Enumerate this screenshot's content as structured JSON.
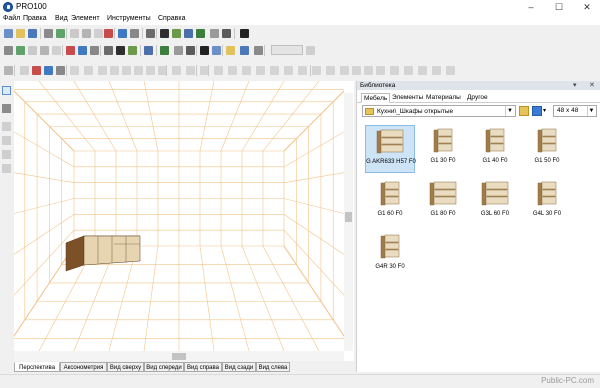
{
  "window": {
    "title": "PRO100",
    "controls": [
      "–",
      "☐",
      "✕"
    ]
  },
  "menu": [
    "Файл",
    "Правка",
    "Вид",
    "Элемент",
    "Инструменты",
    "Справка"
  ],
  "toolbar": {
    "row1_icons": [
      "new-icon",
      "open-icon",
      "save-icon",
      "print-icon",
      "preview-icon",
      "cut-icon",
      "copy-icon",
      "paste-icon",
      "delete-icon",
      "globe-icon",
      "sphere-icon",
      "export-icon",
      "properties-icon",
      "image-icon",
      "layers-icon",
      "report-icon",
      "clone-icon",
      "list-icon",
      "sigma-icon"
    ],
    "zoom_value": ""
  },
  "viewport": {
    "name": "3D-view"
  },
  "view_tabs": [
    "Перспектива",
    "Аксонометрия",
    "Вид сверху",
    "Вид спереди",
    "Вид справа",
    "Вид сзади",
    "Вид слева"
  ],
  "library": {
    "title": "Библиотека",
    "header_buttons": [
      "▾",
      "✕"
    ],
    "tabs": [
      "Мебель",
      "Элементы",
      "Материалы",
      "Другое"
    ],
    "path": "Кухни\\_Шкафы открытые",
    "size": "48 x  48",
    "items": [
      {
        "label": "G AKR633 H57 F0",
        "selected": true,
        "kind": "wide"
      },
      {
        "label": "G1 30 F0",
        "selected": false,
        "kind": "tall"
      },
      {
        "label": "G1 40 F0",
        "selected": false,
        "kind": "tall"
      },
      {
        "label": "G1 50 F0",
        "selected": false,
        "kind": "tall"
      },
      {
        "label": "G1 60 F0",
        "selected": false,
        "kind": "tall"
      },
      {
        "label": "G1 80 F0",
        "selected": false,
        "kind": "wide"
      },
      {
        "label": "G3L 60 F0",
        "selected": false,
        "kind": "wide"
      },
      {
        "label": "G4L 30 F0",
        "selected": false,
        "kind": "tall"
      },
      {
        "label": "G4R 30 F0",
        "selected": false,
        "kind": "tall"
      }
    ]
  },
  "watermark": "Public-PC.com",
  "colors": {
    "grid": "#f2c48a",
    "cabinet_front": "#e6d5b0",
    "cabinet_wood": "#7d5127",
    "selection": "#cde4f7"
  }
}
